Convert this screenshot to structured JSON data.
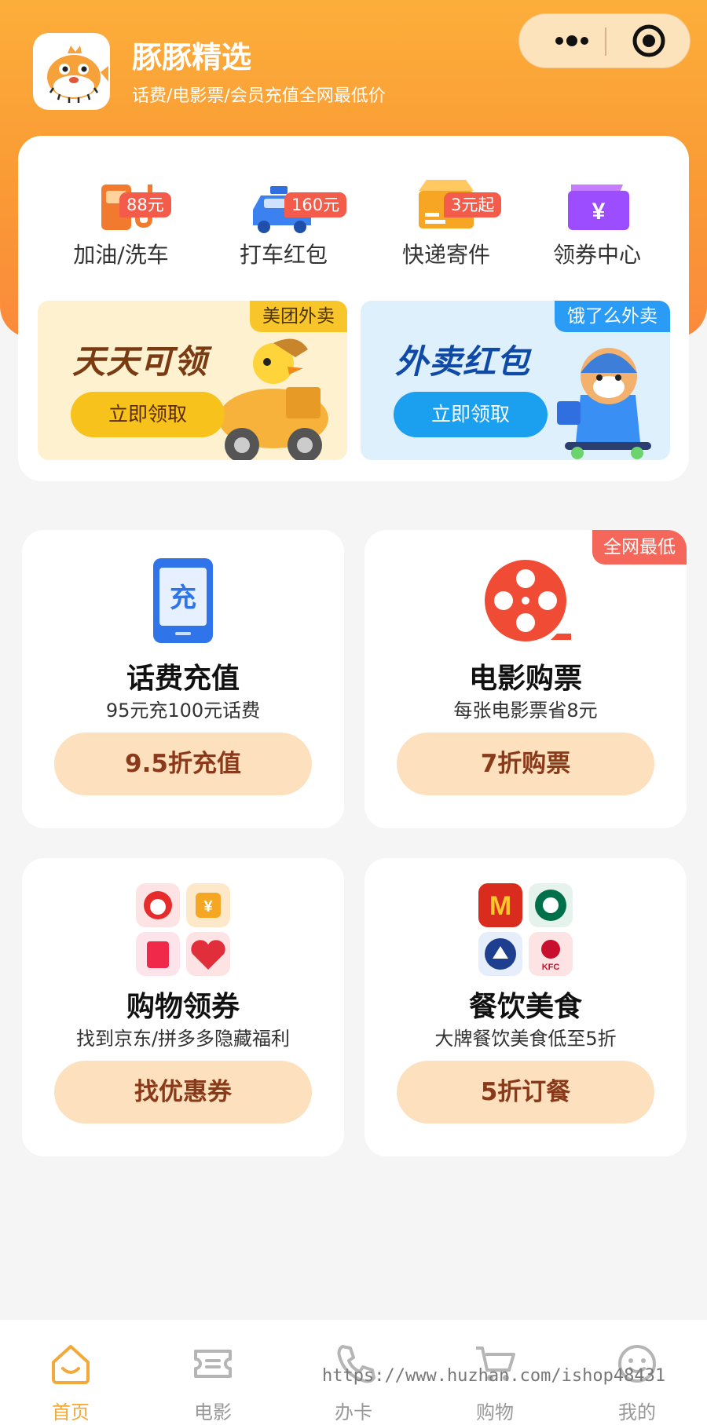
{
  "app": {
    "title": "豚豚精选",
    "subtitle": "话费/电影票/会员充值全网最低价",
    "logo_icon": "pufferfish-logo"
  },
  "capsule": {
    "more_icon": "more-dots-icon",
    "close_icon": "target-circle-icon"
  },
  "quick_items": [
    {
      "label": "加油/洗车",
      "badge": "88元",
      "icon": "gas-pump-icon"
    },
    {
      "label": "打车红包",
      "badge": "160元",
      "icon": "taxi-icon"
    },
    {
      "label": "快递寄件",
      "badge": "3元起",
      "icon": "parcel-box-icon"
    },
    {
      "label": "领券中心",
      "badge": "",
      "icon": "yuan-ticket-icon"
    }
  ],
  "banners": [
    {
      "tag": "美团外卖",
      "title": "天天可领",
      "button": "立即领取"
    },
    {
      "tag": "饿了么外卖",
      "title": "外卖红包",
      "button": "立即领取"
    }
  ],
  "services": [
    {
      "title": "话费充值",
      "subtitle": "95元充100元话费",
      "button": "9.5折充值",
      "corner": "",
      "icon": "phone-recharge-icon"
    },
    {
      "title": "电影购票",
      "subtitle": "每张电影票省8元",
      "button": "7折购票",
      "corner": "全网最低",
      "icon": "film-reel-icon"
    },
    {
      "title": "购物领券",
      "subtitle": "找到京东/拼多多隐藏福利",
      "button": "找优惠券",
      "corner": "",
      "icon": "shopping-apps-icon"
    },
    {
      "title": "餐饮美食",
      "subtitle": "大牌餐饮美食低至5折",
      "button": "5折订餐",
      "corner": "",
      "icon": "food-brands-icon"
    }
  ],
  "tabs": [
    {
      "label": "首页",
      "icon": "home-icon",
      "active": true
    },
    {
      "label": "电影",
      "icon": "ticket-icon",
      "active": false
    },
    {
      "label": "办卡",
      "icon": "phone-handset-icon",
      "active": false
    },
    {
      "label": "购物",
      "icon": "cart-icon",
      "active": false
    },
    {
      "label": "我的",
      "icon": "smiley-icon",
      "active": false
    }
  ],
  "watermark": "https://www.huzhan.com/ishop48431",
  "colors": {
    "brand": "#fa9a35",
    "accent_red": "#f35b4a",
    "button_bg": "#fde0bd",
    "button_text": "#8a3a1a",
    "tab_active": "#f2a93a"
  }
}
